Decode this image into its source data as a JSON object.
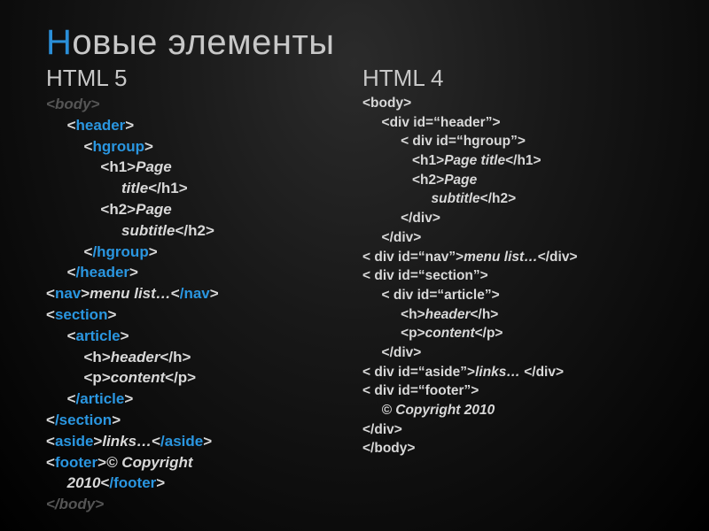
{
  "title_first": "Н",
  "title_rest": "овые элементы",
  "left": {
    "heading": "HTML 5",
    "lines": [
      {
        "segments": [
          {
            "t": "<",
            "c": "fade"
          },
          {
            "t": "body",
            "c": "fade"
          },
          {
            "t": ">",
            "c": "fade"
          }
        ]
      },
      {
        "segments": [
          {
            "t": "     <",
            "c": "br"
          },
          {
            "t": "header",
            "c": "kw"
          },
          {
            "t": ">",
            "c": "br"
          }
        ]
      },
      {
        "segments": [
          {
            "t": "         <",
            "c": "br"
          },
          {
            "t": "hgroup",
            "c": "kw"
          },
          {
            "t": ">",
            "c": "br"
          }
        ]
      },
      {
        "segments": [
          {
            "t": "             <h1>",
            "c": "br"
          },
          {
            "t": "Page",
            "c": "txt"
          }
        ]
      },
      {
        "segments": [
          {
            "t": "                  title",
            "c": "txt"
          },
          {
            "t": "</h1>",
            "c": "br"
          }
        ]
      },
      {
        "segments": [
          {
            "t": "             <h2>",
            "c": "br"
          },
          {
            "t": "Page",
            "c": "txt"
          }
        ]
      },
      {
        "segments": [
          {
            "t": "                  subtitle",
            "c": "txt"
          },
          {
            "t": "</h2>",
            "c": "br"
          }
        ]
      },
      {
        "segments": [
          {
            "t": "         <",
            "c": "br"
          },
          {
            "t": "/hgroup",
            "c": "kw"
          },
          {
            "t": ">",
            "c": "br"
          }
        ]
      },
      {
        "segments": [
          {
            "t": "     <",
            "c": "br"
          },
          {
            "t": "/header",
            "c": "kw"
          },
          {
            "t": ">",
            "c": "br"
          }
        ]
      },
      {
        "segments": [
          {
            "t": "<",
            "c": "br"
          },
          {
            "t": "nav",
            "c": "kw"
          },
          {
            "t": ">",
            "c": "br"
          },
          {
            "t": "menu list…",
            "c": "txt"
          },
          {
            "t": "<",
            "c": "br"
          },
          {
            "t": "/nav",
            "c": "kw"
          },
          {
            "t": ">",
            "c": "br"
          }
        ]
      },
      {
        "segments": [
          {
            "t": "<",
            "c": "br"
          },
          {
            "t": "section",
            "c": "kw"
          },
          {
            "t": ">",
            "c": "br"
          }
        ]
      },
      {
        "segments": [
          {
            "t": "     <",
            "c": "br"
          },
          {
            "t": "article",
            "c": "kw"
          },
          {
            "t": ">",
            "c": "br"
          }
        ]
      },
      {
        "segments": [
          {
            "t": "         <h>",
            "c": "br"
          },
          {
            "t": "header",
            "c": "txt"
          },
          {
            "t": "</h>",
            "c": "br"
          }
        ]
      },
      {
        "segments": [
          {
            "t": "         <p>",
            "c": "br"
          },
          {
            "t": "content",
            "c": "txt"
          },
          {
            "t": "</p>",
            "c": "br"
          }
        ]
      },
      {
        "segments": [
          {
            "t": "     <",
            "c": "br"
          },
          {
            "t": "/article",
            "c": "kw"
          },
          {
            "t": ">",
            "c": "br"
          }
        ]
      },
      {
        "segments": [
          {
            "t": "<",
            "c": "br"
          },
          {
            "t": "/section",
            "c": "kw"
          },
          {
            "t": ">",
            "c": "br"
          }
        ]
      },
      {
        "segments": [
          {
            "t": "<",
            "c": "br"
          },
          {
            "t": "aside",
            "c": "kw"
          },
          {
            "t": ">",
            "c": "br"
          },
          {
            "t": "links…",
            "c": "txt"
          },
          {
            "t": "<",
            "c": "br"
          },
          {
            "t": "/aside",
            "c": "kw"
          },
          {
            "t": ">",
            "c": "br"
          }
        ]
      },
      {
        "segments": [
          {
            "t": "<",
            "c": "br"
          },
          {
            "t": "footer",
            "c": "kw"
          },
          {
            "t": ">",
            "c": "br"
          },
          {
            "t": "© Copyright",
            "c": "txt"
          }
        ]
      },
      {
        "segments": [
          {
            "t": "     2010",
            "c": "txt"
          },
          {
            "t": "<",
            "c": "br"
          },
          {
            "t": "/footer",
            "c": "kw"
          },
          {
            "t": ">",
            "c": "br"
          }
        ]
      },
      {
        "segments": [
          {
            "t": "</body>",
            "c": "fade"
          }
        ]
      }
    ]
  },
  "right": {
    "heading": "HTML 4",
    "lines": [
      {
        "segments": [
          {
            "t": "<body>",
            "c": "br"
          }
        ]
      },
      {
        "segments": [
          {
            "t": "     <div id=“header”>",
            "c": "br"
          }
        ]
      },
      {
        "segments": [
          {
            "t": "          < div id=“hgroup”>",
            "c": "br"
          }
        ]
      },
      {
        "segments": [
          {
            "t": "             <h1>",
            "c": "br"
          },
          {
            "t": "Page title",
            "c": "txt"
          },
          {
            "t": "</h1>",
            "c": "br"
          }
        ]
      },
      {
        "segments": [
          {
            "t": "             <h2>",
            "c": "br"
          },
          {
            "t": "Page",
            "c": "txt"
          }
        ]
      },
      {
        "segments": [
          {
            "t": "                  subtitle",
            "c": "txt"
          },
          {
            "t": "</h2>",
            "c": "br"
          }
        ]
      },
      {
        "segments": [
          {
            "t": "          </div>",
            "c": "br"
          }
        ]
      },
      {
        "segments": [
          {
            "t": "     </div>",
            "c": "br"
          }
        ]
      },
      {
        "segments": [
          {
            "t": "< div id=“nav”>",
            "c": "br"
          },
          {
            "t": "menu list…",
            "c": "txt"
          },
          {
            "t": "</div>",
            "c": "br"
          }
        ]
      },
      {
        "segments": [
          {
            "t": "< div id=“section”>",
            "c": "br"
          }
        ]
      },
      {
        "segments": [
          {
            "t": "     < div id=“article”>",
            "c": "br"
          }
        ]
      },
      {
        "segments": [
          {
            "t": "          <h>",
            "c": "br"
          },
          {
            "t": "header",
            "c": "txt"
          },
          {
            "t": "</h>",
            "c": "br"
          }
        ]
      },
      {
        "segments": [
          {
            "t": "          <p>",
            "c": "br"
          },
          {
            "t": "content",
            "c": "txt"
          },
          {
            "t": "</p>",
            "c": "br"
          }
        ]
      },
      {
        "segments": [
          {
            "t": "     </div>",
            "c": "br"
          }
        ]
      },
      {
        "segments": [
          {
            "t": "< div id=“aside”>",
            "c": "br"
          },
          {
            "t": "links…",
            "c": "txt"
          },
          {
            "t": " </div>",
            "c": "br"
          }
        ]
      },
      {
        "segments": [
          {
            "t": "< div id=“footer”>",
            "c": "br"
          }
        ]
      },
      {
        "segments": [
          {
            "t": "     © Copyright 2010",
            "c": "txt"
          }
        ]
      },
      {
        "segments": [
          {
            "t": "</div>",
            "c": "br"
          }
        ]
      },
      {
        "segments": [
          {
            "t": "</body>",
            "c": "br"
          }
        ]
      }
    ]
  }
}
